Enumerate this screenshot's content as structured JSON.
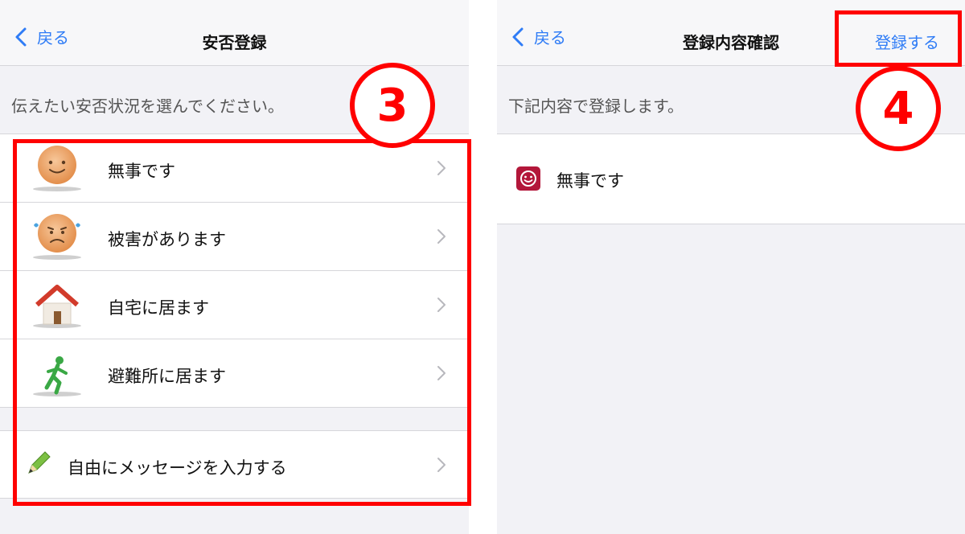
{
  "left": {
    "nav": {
      "back_label": "戻る",
      "title": "安否登録"
    },
    "subtitle": "伝えたい安否状況を選んでください。",
    "items": [
      {
        "label": "無事です",
        "icon": "smiley-face-icon"
      },
      {
        "label": "被害があります",
        "icon": "worried-face-icon"
      },
      {
        "label": "自宅に居ます",
        "icon": "house-icon"
      },
      {
        "label": "避難所に居ます",
        "icon": "running-person-icon"
      }
    ],
    "message_item": {
      "label": "自由にメッセージを入力する",
      "icon": "pencil-icon"
    }
  },
  "right": {
    "nav": {
      "back_label": "戻る",
      "title": "登録内容確認",
      "action_label": "登録する"
    },
    "subtitle": "下記内容で登録します。",
    "selected": {
      "label": "無事です",
      "icon": "smiley-badge-icon"
    }
  },
  "annotations": {
    "step3": "3",
    "step4": "4"
  },
  "colors": {
    "accent": "#2f7cf6",
    "annotation": "#ff0000",
    "badge": "#b3173a"
  }
}
